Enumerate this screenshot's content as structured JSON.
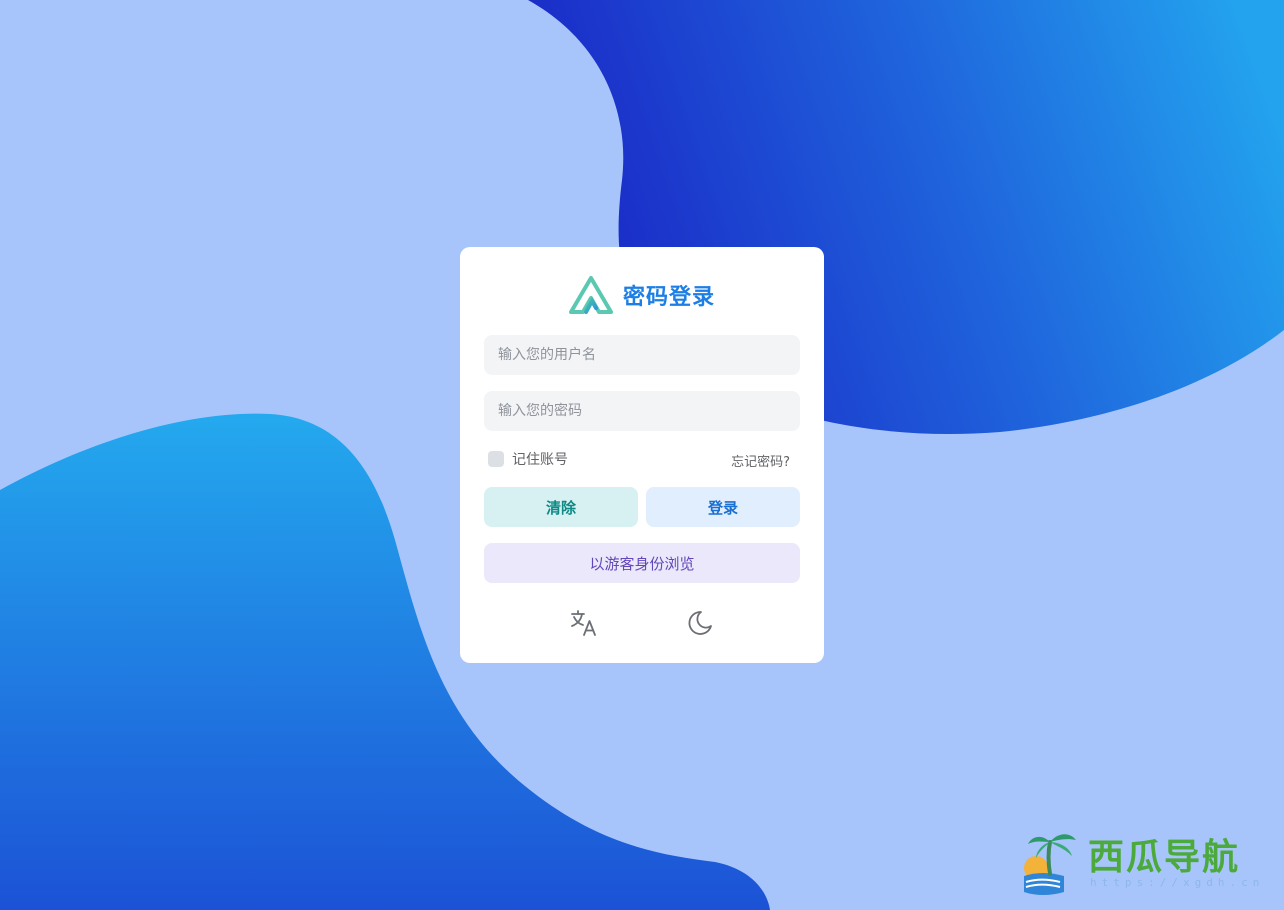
{
  "login": {
    "title": "密码登录",
    "username_placeholder": "输入您的用户名",
    "password_placeholder": "输入您的密码",
    "remember_label": "记住账号",
    "forgot_label": "忘记密码?",
    "clear_label": "清除",
    "login_label": "登录",
    "guest_label": "以游客身份浏览"
  },
  "icons": {
    "logo": "logo-icon",
    "language": "translate-icon",
    "theme": "moon-icon"
  },
  "watermark": {
    "name": "西瓜导航",
    "url": "https://xgdh.cn"
  },
  "colors": {
    "background": "#a8c5fb",
    "title": "#1d7fe6",
    "clear_bg": "#d7f1f2",
    "login_bg": "#e1eefd",
    "guest_bg": "#ebe8fb"
  }
}
